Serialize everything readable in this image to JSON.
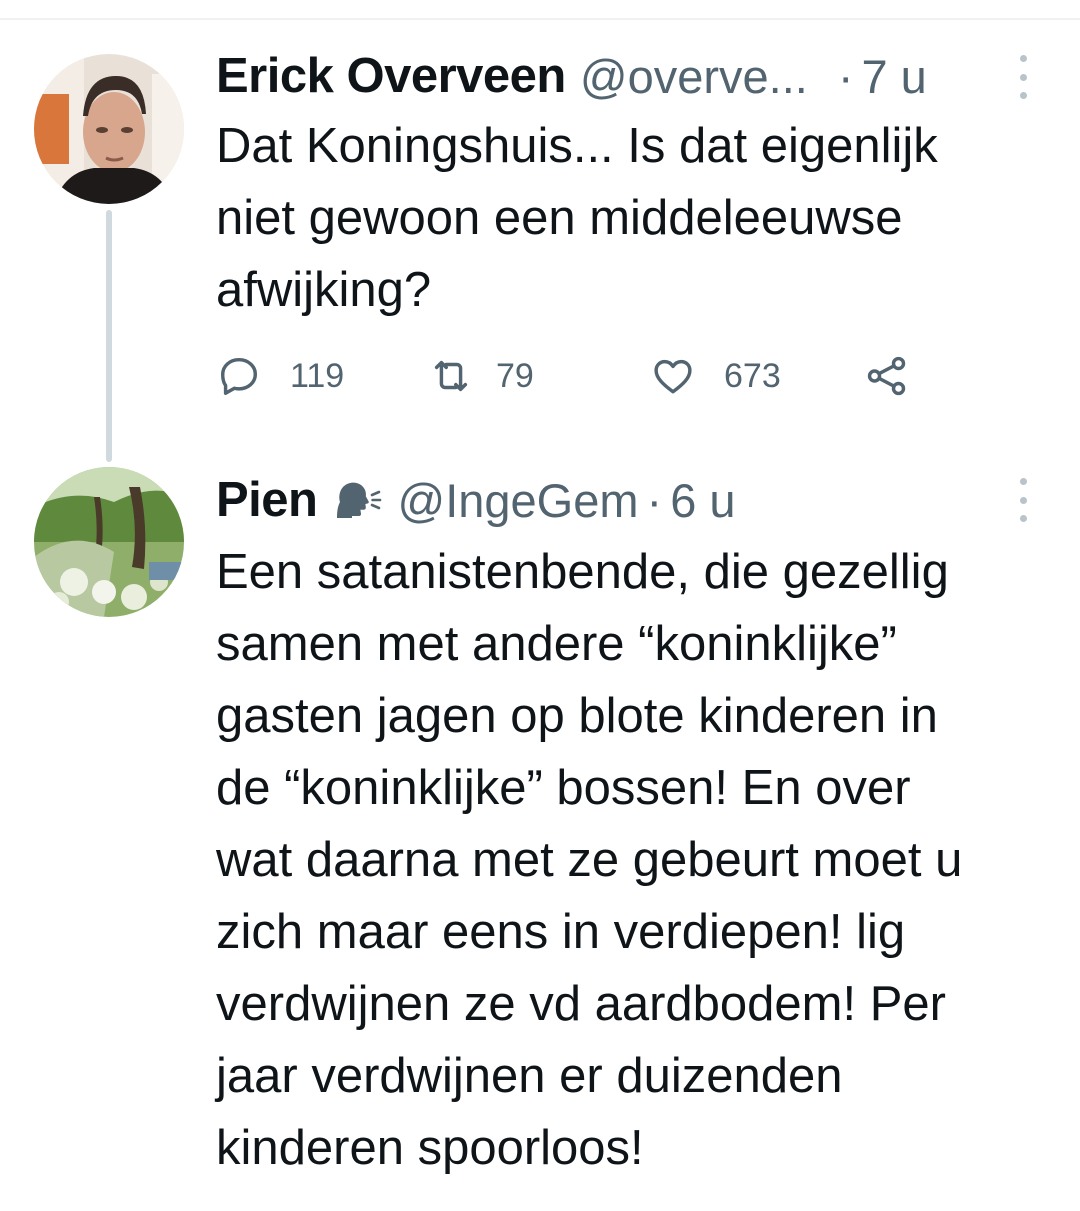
{
  "tweets": [
    {
      "author_name": "Erick Overveen",
      "handle": "@overve...",
      "separator": "·",
      "time": "7 u",
      "text": "Dat Koningshuis... Is dat eigenlijk\nniet gewoon een middeleeuwse\nafwijking?",
      "avatar_icon": "profile-photo-man",
      "actions": {
        "replies": "119",
        "retweets": "79",
        "likes": "673"
      }
    },
    {
      "author_name": "Pien",
      "name_emoji": "speaking-head-icon",
      "handle": "@IngeGem",
      "separator": "·",
      "time": "6 u",
      "text": "Een satanistenbende, die gezellig\nsamen met andere “koninklijke”\ngasten jagen op blote kinderen in\nde “koninklijke” bossen! En over\nwat daarna met ze gebeurt moet u\nzich maar eens in verdiepen! lig\nverdwijnen ze vd aardbodem! Per\njaar verdwijnen er duizenden\nkinderen spoorloos!",
      "avatar_icon": "profile-photo-landscape"
    }
  ],
  "colors": {
    "text_primary": "#0f1419",
    "text_secondary": "#536471",
    "thread_line": "#cfd9de"
  }
}
